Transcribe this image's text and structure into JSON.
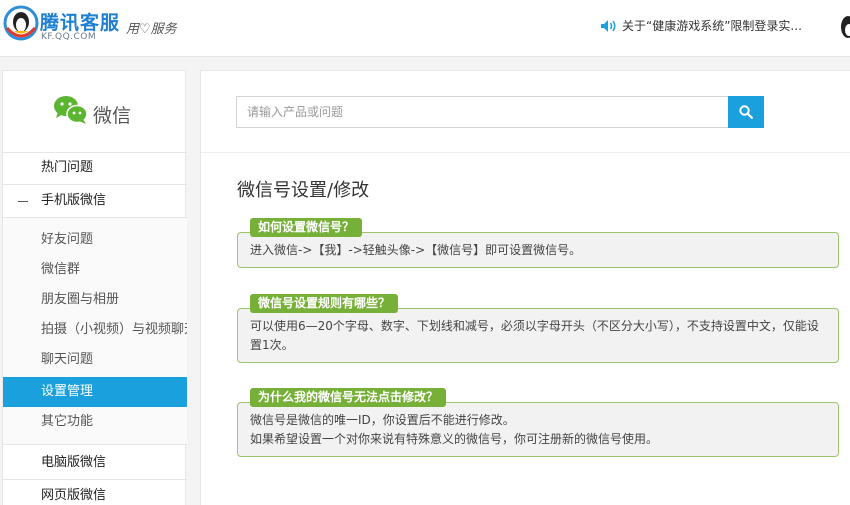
{
  "header": {
    "logo_title": "腾讯客服",
    "logo_sub": "KF.QQ.COM",
    "slogan": "用♡服务",
    "notice": "关于“健康游戏系统”限制登录实..."
  },
  "sidebar": {
    "brand_name": "微信",
    "items": [
      {
        "label": "热门问题"
      },
      {
        "label": "手机版微信"
      },
      {
        "label": "好友问题"
      },
      {
        "label": "微信群"
      },
      {
        "label": "朋友圈与相册"
      },
      {
        "label": "拍摄（小视频）与视频聊天"
      },
      {
        "label": "聊天问题"
      },
      {
        "label": "设置管理"
      },
      {
        "label": "其它功能"
      },
      {
        "label": "电脑版微信"
      },
      {
        "label": "网页版微信"
      }
    ]
  },
  "main": {
    "search_placeholder": "请输入产品或问题",
    "page_title": "微信号设置/修改",
    "faqs": [
      {
        "q": "如何设置微信号？",
        "a": "进入微信->【我】->轻触头像->【微信号】即可设置微信号。"
      },
      {
        "q": "微信号设置规则有哪些？",
        "a": "可以使用6—20个字母、数字、下划线和减号，必须以字母开头（不区分大小写），不支持设置中文，仅能设置1次。"
      },
      {
        "q": "为什么我的微信号无法点击修改？",
        "a1": "微信号是微信的唯一ID，你设置后不能进行修改。",
        "a2": "如果希望设置一个对你来说有特殊意义的微信号，你可注册新的微信号使用。"
      }
    ]
  },
  "colors": {
    "accent": "#1aa0dc",
    "faq_label": "#77b039",
    "faq_border": "#9cc46a"
  }
}
